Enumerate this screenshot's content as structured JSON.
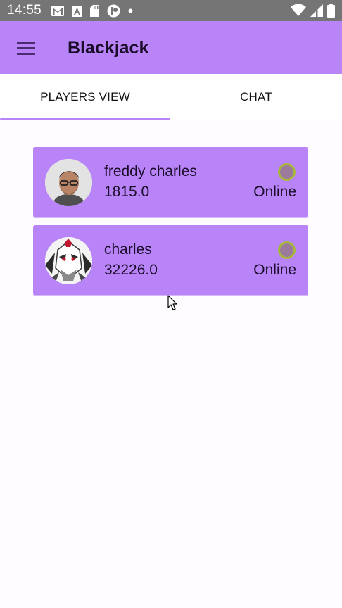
{
  "status_bar": {
    "time": "14:55",
    "left_icons": [
      "gmail-icon",
      "font-icon",
      "sd-card-icon",
      "app-icon",
      "dot-icon"
    ],
    "right_icons": [
      "wifi-icon",
      "signal-icon",
      "battery-icon"
    ]
  },
  "app_bar": {
    "title": "Blackjack",
    "menu_icon": "menu-icon",
    "background": "#b984f8"
  },
  "tabs": [
    {
      "label": "PLAYERS VIEW",
      "selected": true
    },
    {
      "label": "CHAT",
      "selected": false
    }
  ],
  "players": [
    {
      "name": "freddy charles",
      "score": "1815.0",
      "status": "Online",
      "avatar": "person-photo-icon"
    },
    {
      "name": "charles",
      "score": "32226.0",
      "status": "Online",
      "avatar": "anime-character-icon"
    }
  ],
  "colors": {
    "accent": "#b984f8",
    "status_ring": "#a6b93a",
    "status_fill": "#9b7a9c",
    "status_bar": "#757575"
  }
}
